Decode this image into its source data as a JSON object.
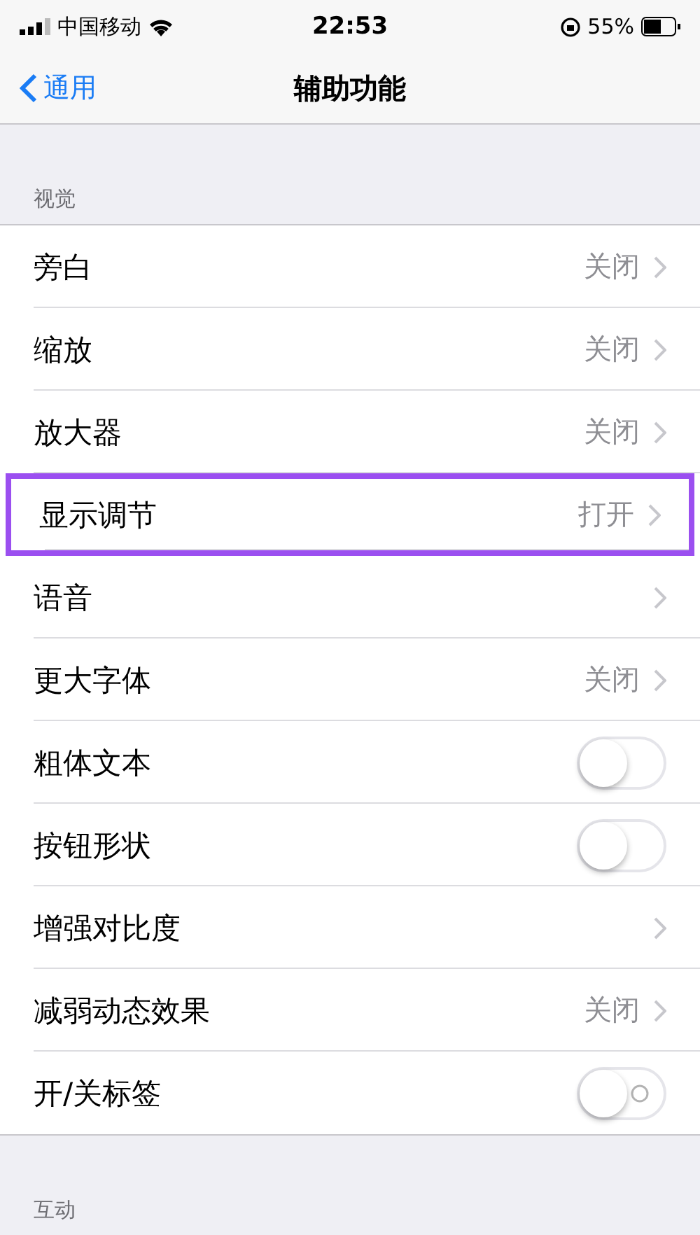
{
  "status_bar": {
    "carrier": "中国移动",
    "time": "22:53",
    "battery": "55%"
  },
  "nav": {
    "back": "通用",
    "title": "辅助功能"
  },
  "sections": [
    {
      "header": "视觉",
      "rows": [
        {
          "kind": "link",
          "label": "旁白",
          "value": "关闭",
          "highlighted": false
        },
        {
          "kind": "link",
          "label": "缩放",
          "value": "关闭",
          "highlighted": false
        },
        {
          "kind": "link",
          "label": "放大器",
          "value": "关闭",
          "highlighted": false
        },
        {
          "kind": "link",
          "label": "显示调节",
          "value": "打开",
          "highlighted": true
        },
        {
          "kind": "link",
          "label": "语音",
          "highlighted": false
        },
        {
          "kind": "link",
          "label": "更大字体",
          "value": "关闭",
          "highlighted": false
        },
        {
          "kind": "toggle",
          "label": "粗体文本",
          "on": false,
          "highlighted": false
        },
        {
          "kind": "toggle",
          "label": "按钮形状",
          "on": false,
          "highlighted": false
        },
        {
          "kind": "link",
          "label": "增强对比度",
          "highlighted": false
        },
        {
          "kind": "link",
          "label": "减弱动态效果",
          "value": "关闭",
          "highlighted": false
        },
        {
          "kind": "toggle",
          "label": "开/关标签",
          "on": false,
          "label_mark": true,
          "highlighted": false
        }
      ]
    },
    {
      "header": "互动"
    }
  ]
}
